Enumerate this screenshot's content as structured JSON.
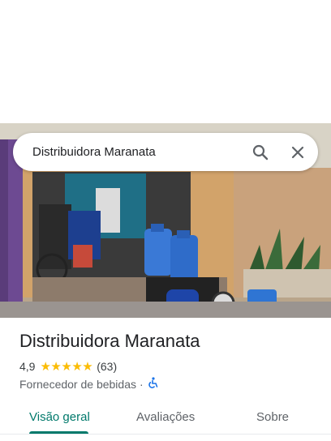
{
  "search": {
    "query": "Distribuidora Maranata"
  },
  "place": {
    "name": "Distribuidora Maranata",
    "rating": "4,9",
    "stars": 5,
    "review_count": "(63)",
    "category": "Fornecedor de bebidas",
    "separator": "·",
    "accessibility_icon": "wheelchair-icon"
  },
  "tabs": [
    {
      "label": "Visão geral",
      "active": true
    },
    {
      "label": "Avaliações",
      "active": false
    },
    {
      "label": "Sobre",
      "active": false
    }
  ],
  "icons": {
    "search": "search-icon",
    "close": "close-icon"
  },
  "colors": {
    "accent": "#00796b",
    "star": "#fbbc04",
    "accessibility": "#1a73e8"
  }
}
